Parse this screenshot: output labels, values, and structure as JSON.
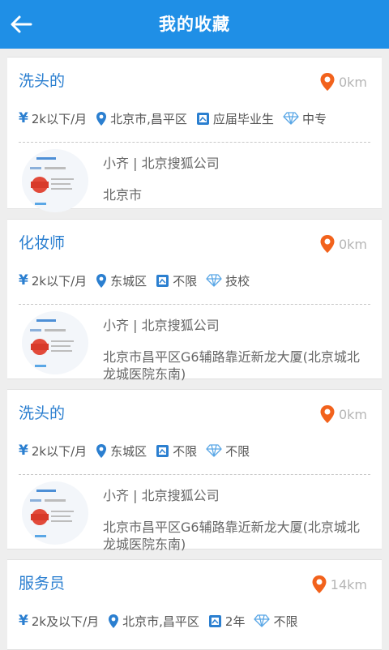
{
  "header": {
    "title": "我的收藏"
  },
  "jobs": [
    {
      "title": "洗头的",
      "distance": "0km",
      "salary": "2k以下/月",
      "location": "北京市,昌平区",
      "education": "应届毕业生",
      "degree": "中专",
      "company": "小齐 | 北京搜狐公司",
      "address": "北京市"
    },
    {
      "title": "化妆师",
      "distance": "0km",
      "salary": "2k以下/月",
      "location": "东城区",
      "education": "不限",
      "degree": "技校",
      "company": "小齐 | 北京搜狐公司",
      "address": "北京市昌平区G6辅路靠近新龙大厦(北京城北龙城医院东南)"
    },
    {
      "title": "洗头的",
      "distance": "0km",
      "salary": "2k以下/月",
      "location": "东城区",
      "education": "不限",
      "degree": "不限",
      "company": "小齐 | 北京搜狐公司",
      "address": "北京市昌平区G6辅路靠近新龙大厦(北京城北龙城医院东南)"
    },
    {
      "title": "服务员",
      "distance": "14km",
      "salary": "2k及以下/月",
      "location": "北京市,昌平区",
      "education": "2年",
      "degree": "不限"
    }
  ],
  "colors": {
    "header": "#1f8fe6",
    "title": "#2b7fd0",
    "pin": "#f2621c"
  },
  "icons": {
    "back": "back-arrow-icon",
    "distance": "map-pin-icon",
    "salary": "yen-icon",
    "location": "location-pin-icon",
    "education": "education-icon",
    "degree": "diamond-icon"
  }
}
